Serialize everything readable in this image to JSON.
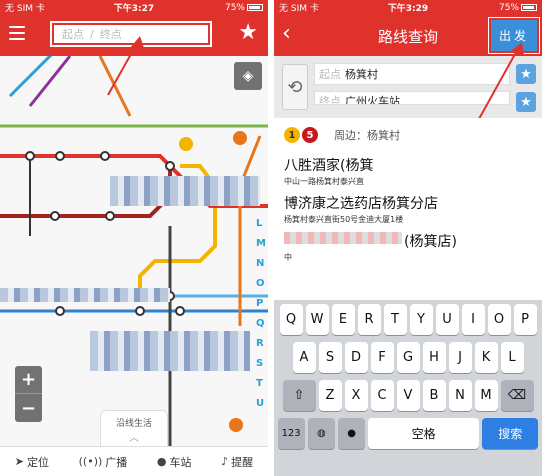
{
  "left": {
    "status": {
      "carrier": "无 SIM 卡",
      "time": "下午3:27",
      "battery": "75%"
    },
    "search": {
      "start_placeholder": "起点",
      "end_placeholder": "终点"
    },
    "map": {
      "along_tab_label": "沿线生活"
    },
    "bottom_nav": [
      {
        "label": "定位",
        "icon": "location-icon"
      },
      {
        "label": "广播",
        "icon": "broadcast-icon"
      },
      {
        "label": "车站",
        "icon": "station-pin-icon"
      },
      {
        "label": "提醒",
        "icon": "bell-icon"
      }
    ]
  },
  "right": {
    "status": {
      "carrier": "无 SIM 卡",
      "time": "下午3:29",
      "battery": "75%"
    },
    "title": "路线查询",
    "go_button": "出发",
    "route": {
      "start_label": "起点",
      "start_value": "杨箕村",
      "end_label": "终点",
      "end_value": "广州火车站"
    },
    "nearby": {
      "lines": [
        "1",
        "5"
      ],
      "text": "周边：杨箕村"
    },
    "results": [
      {
        "name": "八胜酒家(杨箕",
        "address": "中山一路杨箕村泰兴直"
      },
      {
        "name": "博济康之选药店杨箕分店",
        "address": "杨箕村泰兴直街50号金迪大厦1楼"
      },
      {
        "name": "(杨箕店)",
        "address": "中"
      }
    ],
    "keyboard": {
      "row1": [
        "Q",
        "W",
        "E",
        "R",
        "T",
        "Y",
        "U",
        "I",
        "O",
        "P"
      ],
      "row2": [
        "A",
        "S",
        "D",
        "F",
        "G",
        "H",
        "J",
        "K",
        "L"
      ],
      "row3": [
        "Z",
        "X",
        "C",
        "V",
        "B",
        "N",
        "M"
      ],
      "num_key": "123",
      "space_key": "空格",
      "search_key": "搜索"
    }
  },
  "colors": {
    "primary_red": "#e0322d",
    "accent_blue": "#3a90d8"
  }
}
